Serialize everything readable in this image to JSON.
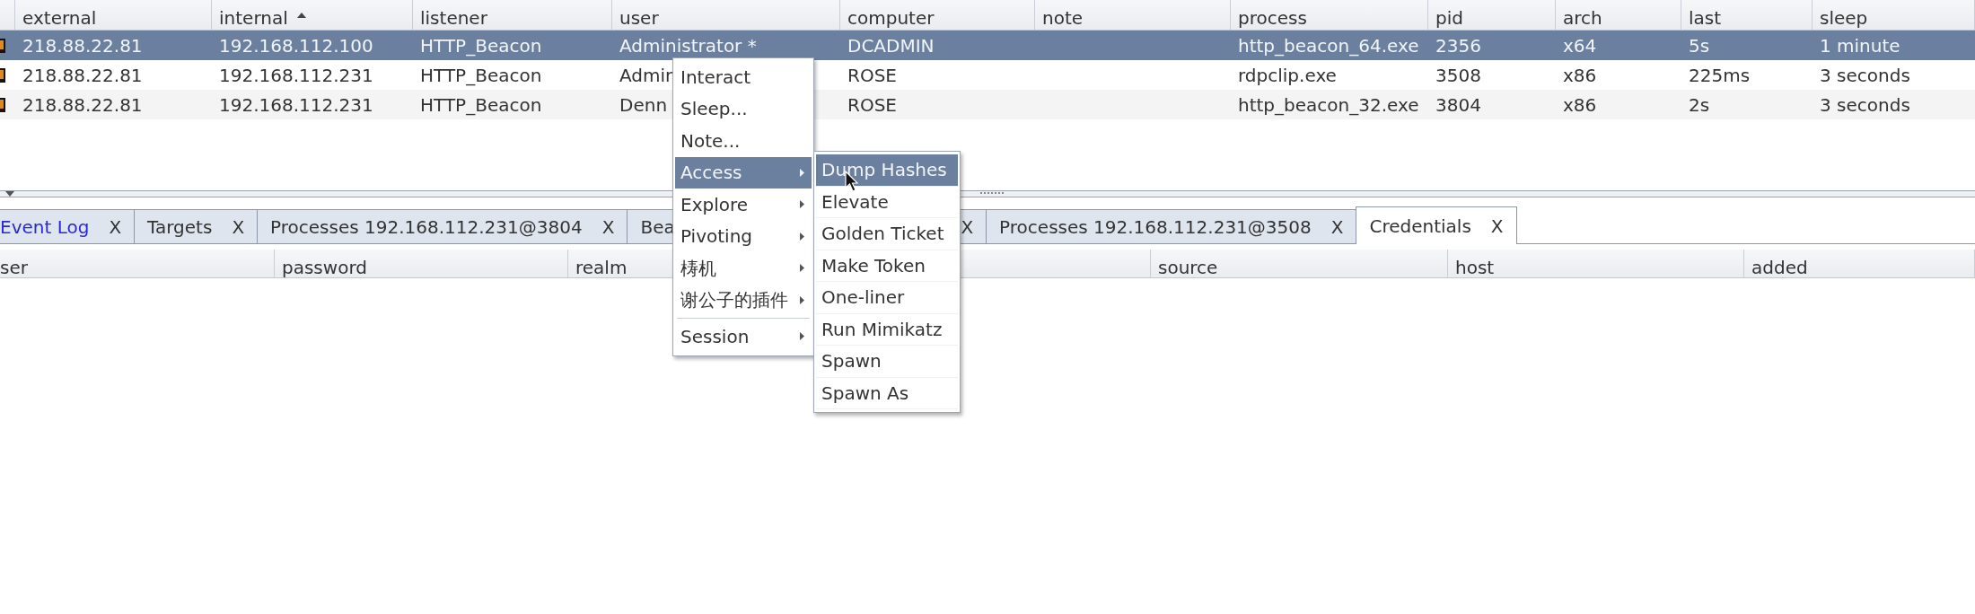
{
  "beacons": {
    "columns": [
      {
        "label": "external"
      },
      {
        "label": "internal",
        "sort_ascending": true
      },
      {
        "label": "listener"
      },
      {
        "label": "user"
      },
      {
        "label": "computer"
      },
      {
        "label": "note"
      },
      {
        "label": "process"
      },
      {
        "label": "pid"
      },
      {
        "label": "arch"
      },
      {
        "label": "last"
      },
      {
        "label": "sleep"
      }
    ],
    "rows": [
      {
        "selected": true,
        "cells": [
          "218.88.22.81",
          "192.168.112.100",
          "HTTP_Beacon",
          "Administrator *",
          "DCADMIN",
          null,
          "http_beacon_64.exe",
          "2356",
          "x64",
          "5s",
          "1 minute"
        ]
      },
      {
        "selected": false,
        "cells": [
          "218.88.22.81",
          "192.168.112.231",
          "HTTP_Beacon",
          "Admin",
          "ROSE",
          null,
          "rdpclip.exe",
          "3508",
          "x86",
          "225ms",
          "3 seconds"
        ]
      },
      {
        "selected": false,
        "cells": [
          "218.88.22.81",
          "192.168.112.231",
          "HTTP_Beacon",
          "Denn",
          "ROSE",
          null,
          "http_beacon_32.exe",
          "3804",
          "x86",
          "2s",
          "3 seconds"
        ]
      }
    ]
  },
  "tabs": [
    {
      "label": "Event Log",
      "close": "X",
      "selected": false,
      "alert": true
    },
    {
      "label": "Targets",
      "close": "X",
      "selected": false,
      "alert": false
    },
    {
      "label": "Processes 192.168.112.231@3804",
      "close": "X",
      "selected": false,
      "alert": false
    },
    {
      "label": "Bea",
      "close": "X",
      "selected": false,
      "alert": false
    },
    {
      "label": "Processes 192.168.112.231@3508",
      "close": "X",
      "selected": false,
      "alert": false
    },
    {
      "label": "Credentials",
      "close": "X",
      "selected": true,
      "alert": false
    }
  ],
  "credentials": {
    "columns": [
      {
        "label": "ser"
      },
      {
        "label": "password"
      },
      {
        "label": "realm"
      },
      {
        "label": "source"
      },
      {
        "label": "host"
      },
      {
        "label": "added"
      }
    ]
  },
  "context_menu": {
    "items": [
      {
        "kind": "action",
        "label": "Interact",
        "selected": false
      },
      {
        "kind": "action",
        "label": "Sleep...",
        "selected": false
      },
      {
        "kind": "action",
        "label": "Note...",
        "selected": false
      },
      {
        "kind": "submenu",
        "label": "Access",
        "selected": true
      },
      {
        "kind": "submenu",
        "label": "Explore",
        "selected": false
      },
      {
        "kind": "submenu",
        "label": "Pivoting",
        "selected": false
      },
      {
        "kind": "submenu",
        "label": "梼机",
        "selected": false
      },
      {
        "kind": "submenu",
        "label": "谢公子的插件",
        "selected": false
      },
      {
        "kind": "separator"
      },
      {
        "kind": "submenu",
        "label": "Session",
        "selected": false
      }
    ]
  },
  "submenu": {
    "items": [
      {
        "kind": "action",
        "label": "Dump Hashes",
        "selected": true
      },
      {
        "kind": "action",
        "label": "Elevate",
        "selected": false
      },
      {
        "kind": "action",
        "label": "Golden Ticket",
        "selected": false
      },
      {
        "kind": "action",
        "label": "Make Token",
        "selected": false
      },
      {
        "kind": "action",
        "label": "One-liner",
        "selected": false
      },
      {
        "kind": "action",
        "label": "Run Mimikatz",
        "selected": false
      },
      {
        "kind": "action",
        "label": "Spawn",
        "selected": false
      },
      {
        "kind": "action",
        "label": "Spawn As",
        "selected": false
      }
    ]
  }
}
